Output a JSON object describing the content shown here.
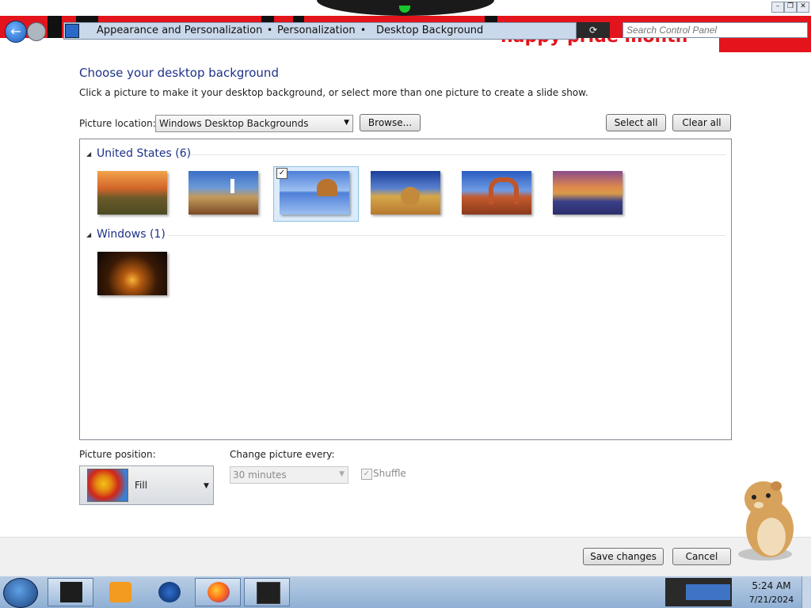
{
  "address_bar": {
    "breadcrumbs": [
      "Appearance and Personalization",
      "Personalization",
      "Desktop Background"
    ],
    "separator": "•",
    "search_placeholder": "Search Control Panel",
    "banner_text": "happy pride month",
    "refresh_label": "⟳"
  },
  "window_controls": {
    "minimize": "–",
    "maximize": "❐",
    "close": "✕"
  },
  "page": {
    "title": "Choose your desktop background",
    "instructions": "Click a picture to make it your desktop background, or select more than one picture to create a slide show.",
    "picture_location_label": "Picture location:",
    "picture_location_value": "Windows Desktop Backgrounds",
    "browse_label": "Browse...",
    "select_all_label": "Select all",
    "clear_all_label": "Clear all"
  },
  "gallery": {
    "groups": [
      {
        "title": "United States (6)",
        "thumbnails": [
          "sunset-field",
          "lighthouse",
          "rock-reflection",
          "hay-bale",
          "arch",
          "lake-sunset"
        ],
        "selected_index": 2
      },
      {
        "title": "Windows (1)",
        "thumbnails": [
          "windows-swirl"
        ]
      }
    ],
    "check_mark": "✓"
  },
  "options": {
    "position_label": "Picture position:",
    "position_value": "Fill",
    "change_label": "Change picture every:",
    "change_value": "30 minutes",
    "shuffle_label": "Shuffle"
  },
  "footer": {
    "save_label": "Save changes",
    "cancel_label": "Cancel"
  },
  "taskbar": {
    "time": "5:24 AM",
    "date": "7/21/2024"
  },
  "colors": {
    "heading": "#1e3287",
    "banner_red": "#e3141b",
    "selection": "#dcecfb"
  }
}
